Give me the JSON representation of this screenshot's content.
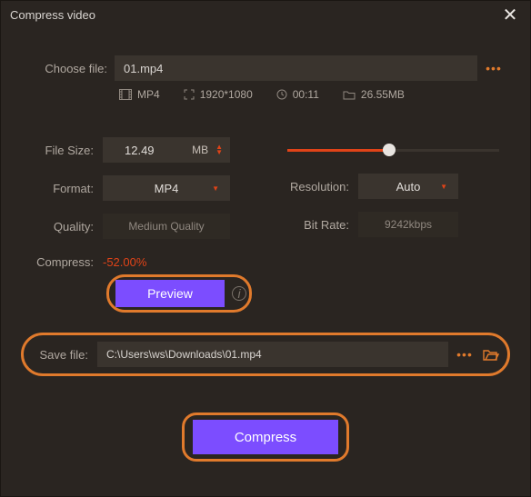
{
  "window": {
    "title": "Compress video"
  },
  "choose": {
    "label": "Choose file:",
    "value": "01.mp4"
  },
  "meta": {
    "format": "MP4",
    "resolution": "1920*1080",
    "duration": "00:11",
    "size": "26.55MB"
  },
  "fileSize": {
    "label": "File Size:",
    "value": "12.49",
    "unit": "MB"
  },
  "format": {
    "label": "Format:",
    "value": "MP4"
  },
  "quality": {
    "label": "Quality:",
    "value": "Medium Quality"
  },
  "resolution": {
    "label": "Resolution:",
    "value": "Auto"
  },
  "bitrate": {
    "label": "Bit Rate:",
    "value": "9242kbps"
  },
  "compressPct": {
    "label": "Compress:",
    "value": "-52.00%"
  },
  "preview": {
    "label": "Preview"
  },
  "save": {
    "label": "Save file:",
    "value": "C:\\Users\\ws\\Downloads\\01.mp4"
  },
  "action": {
    "label": "Compress"
  }
}
